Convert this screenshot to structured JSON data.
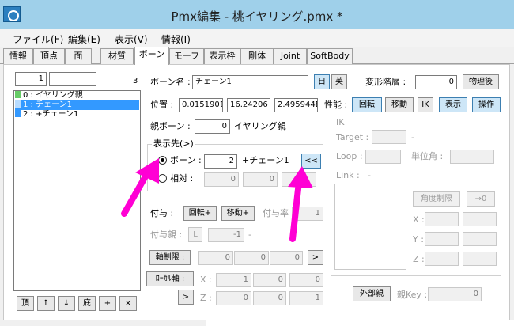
{
  "window": {
    "title": "Pmx編集 - 桃イヤリング.pmx *"
  },
  "menu": [
    "ファイル(F)",
    "編集(E)",
    "表示(V)",
    "情報(I)"
  ],
  "tabs": [
    "情報",
    "頂点",
    "面",
    "材質",
    "ボーン",
    "モーフ",
    "表示枠",
    "剛体",
    "Joint",
    "SoftBody"
  ],
  "bone_list": {
    "index_value": "1",
    "search_value": "",
    "count": "3",
    "items": [
      {
        "label": "0 : イヤリング親",
        "color": "#66cc66"
      },
      {
        "label": "1 : チェーン1",
        "color": "#3399ff"
      },
      {
        "label": "2 : +チェーン1",
        "color": "#3399ff"
      }
    ],
    "buttons": [
      "頂",
      "↑",
      "↓",
      "底",
      "+",
      "×"
    ]
  },
  "bone": {
    "name_label": "ボーン名 :",
    "name": "チェーン1",
    "jp": "日",
    "en": "英",
    "deform_label": "変形階層 :",
    "deform": "0",
    "physics_after": "物理後",
    "pos_label": "位置 :",
    "pos": [
      "0.0151901",
      "16.24206",
      "2.495944E"
    ],
    "perf_label": "性能 :",
    "perf": [
      "回転",
      "移動",
      "IK",
      "表示",
      "操作"
    ],
    "parent_label": "親ボーン :",
    "parent": "0",
    "parent_name": "イヤリング親",
    "display_label": "表示先(>)",
    "radio_bone": "ボーン :",
    "tail_bone": "2",
    "tail_name": "+チェーン1",
    "tail_btn": "<<",
    "radio_rel": "相対 :",
    "rel": [
      "0",
      "0"
    ],
    "grant_label": "付与 :",
    "grant_rot": "回転+",
    "grant_move": "移動+",
    "grant_rate_label": "付与率",
    "grant_rate": "1",
    "grant_parent_label": "付与親 :",
    "grant_parent_btn": "L",
    "grant_parent": "-1",
    "grant_parent_tail": "-",
    "axis_btn": "軸制限 :",
    "axis": [
      "0",
      "0",
      "0"
    ],
    "axis_go": ">",
    "local_btn": "ﾛｰｶﾙ軸 :",
    "x_label": "X :",
    "z_label": "Z :",
    "local_x": [
      "1",
      "0",
      "0"
    ],
    "local_go": ">",
    "local_z": [
      "0",
      "0",
      "1"
    ],
    "ext_parent": "外部親",
    "parent_key_label": "親Key :",
    "parent_key": "0"
  },
  "ik": {
    "title": "IK",
    "target_label": "Target :",
    "target_dash": "-",
    "loop_label": "Loop :",
    "unit_label": "単位角 :",
    "link_label": "Link :",
    "link_dash": "-",
    "limit_btn": "角度制限",
    "zero_btn": "→0",
    "x": "X :",
    "y": "Y :",
    "z": "Z :"
  }
}
